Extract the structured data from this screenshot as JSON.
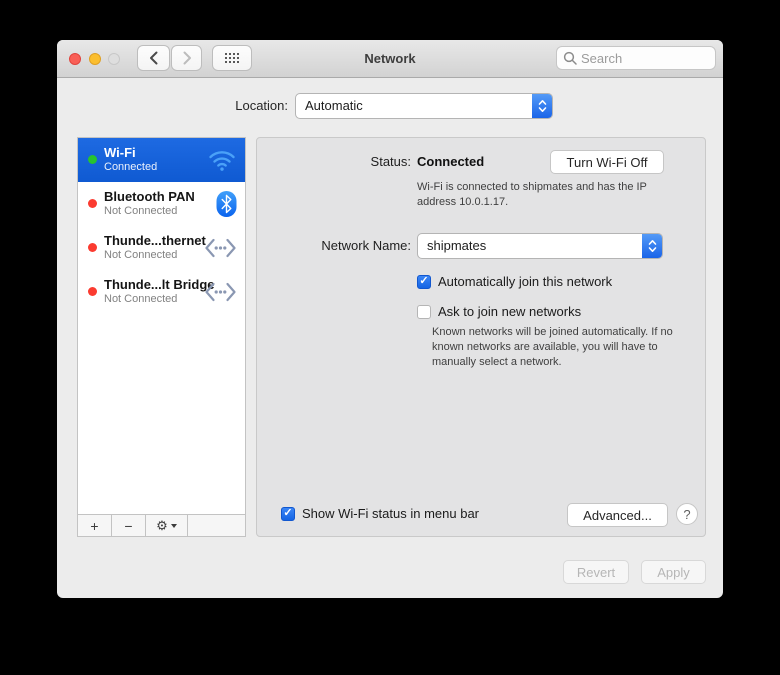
{
  "window": {
    "title": "Network"
  },
  "titlebar": {
    "search_placeholder": "Search"
  },
  "location": {
    "label": "Location:",
    "value": "Automatic"
  },
  "sidebar": {
    "items": [
      {
        "name": "Wi-Fi",
        "status": "Connected",
        "icon": "wifi-icon",
        "dot_color": "#27c32f",
        "selected": true
      },
      {
        "name": "Bluetooth PAN",
        "status": "Not Connected",
        "icon": "bluetooth-icon",
        "dot_color": "#fb3b30",
        "selected": false
      },
      {
        "name": "Thunde...thernet",
        "status": "Not Connected",
        "icon": "ethernet-icon",
        "dot_color": "#fb3b30",
        "selected": false
      },
      {
        "name": "Thunde...lt Bridge",
        "status": "Not Connected",
        "icon": "ethernet-icon",
        "dot_color": "#fb3b30",
        "selected": false
      }
    ],
    "add_button": "+",
    "remove_button": "−"
  },
  "main": {
    "status_label": "Status:",
    "status_value": "Connected",
    "turn_wifi_off_button": "Turn Wi-Fi Off",
    "status_description": "Wi-Fi is connected to shipmates and has the IP address 10.0.1.17.",
    "network_name_label": "Network Name:",
    "network_name_value": "shipmates",
    "auto_join": {
      "label": "Automatically join this network",
      "checked": true
    },
    "ask_join": {
      "label": "Ask to join new networks",
      "checked": false
    },
    "ask_join_description": "Known networks will be joined automatically. If no known networks are available, you will have to manually select a network.",
    "menu_bar": {
      "label": "Show Wi-Fi status in menu bar",
      "checked": true
    },
    "advanced_button": "Advanced...",
    "help_button": "?"
  },
  "footer": {
    "revert_button": "Revert",
    "apply_button": "Apply"
  },
  "icons": {
    "checkmark": "✓",
    "gear": "⚙"
  },
  "colors": {
    "selection_blue": "#1563dd",
    "popup_blue": "#2f7cf6",
    "connected_green": "#27c32f",
    "disconnected_red": "#fb3b30",
    "window_bg": "#ececec",
    "panel_bg": "#e3e3e4"
  }
}
